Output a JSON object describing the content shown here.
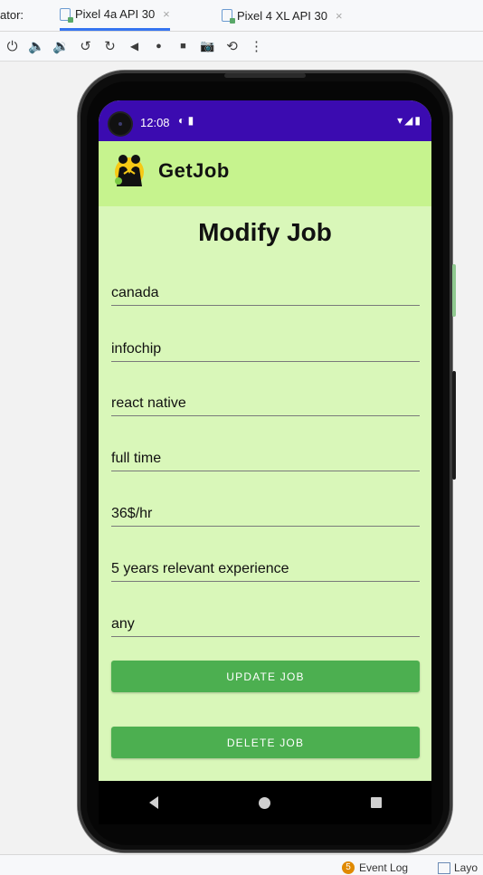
{
  "ide": {
    "tab_prefix": "ator:",
    "tabs": [
      {
        "label": "Pixel 4a API 30",
        "close": "×"
      },
      {
        "label": "Pixel 4 XL API 30",
        "close": "×"
      }
    ],
    "toolbar_icons": [
      "power-icon",
      "volume-up-icon",
      "volume-down-icon",
      "rotate-left-icon",
      "rotate-right-icon",
      "back-icon",
      "home-icon",
      "overview-icon",
      "screenshot-icon",
      "snapshot-icon",
      "more-icon"
    ],
    "toolbar_glyphs": [
      "⏻",
      "🔈",
      "🔉",
      "↺",
      "↻",
      "◀",
      "●",
      "■",
      "📷",
      "⟲",
      "⋮"
    ],
    "bottom": {
      "event_log_count": "5",
      "event_log_label": "Event Log",
      "layout_label": "Layo"
    }
  },
  "status_bar": {
    "time": "12:08",
    "left_icons": "◐ ▮",
    "right_icons": "▾◢▮",
    "color": "#3b0bb0"
  },
  "app_bar": {
    "brand": "GetJob",
    "color": "#c6f38e"
  },
  "page": {
    "title": "Modify Job",
    "background": "#d9f7b9"
  },
  "form": {
    "location": "canada",
    "company": "infochip",
    "skill": "react native",
    "job_type": "full time",
    "salary": "36$/hr",
    "experience": "5 years relevant experience",
    "extra": "any"
  },
  "buttons": {
    "update": "UPDATE JOB",
    "delete": "DELETE JOB",
    "color": "#4caf50"
  }
}
